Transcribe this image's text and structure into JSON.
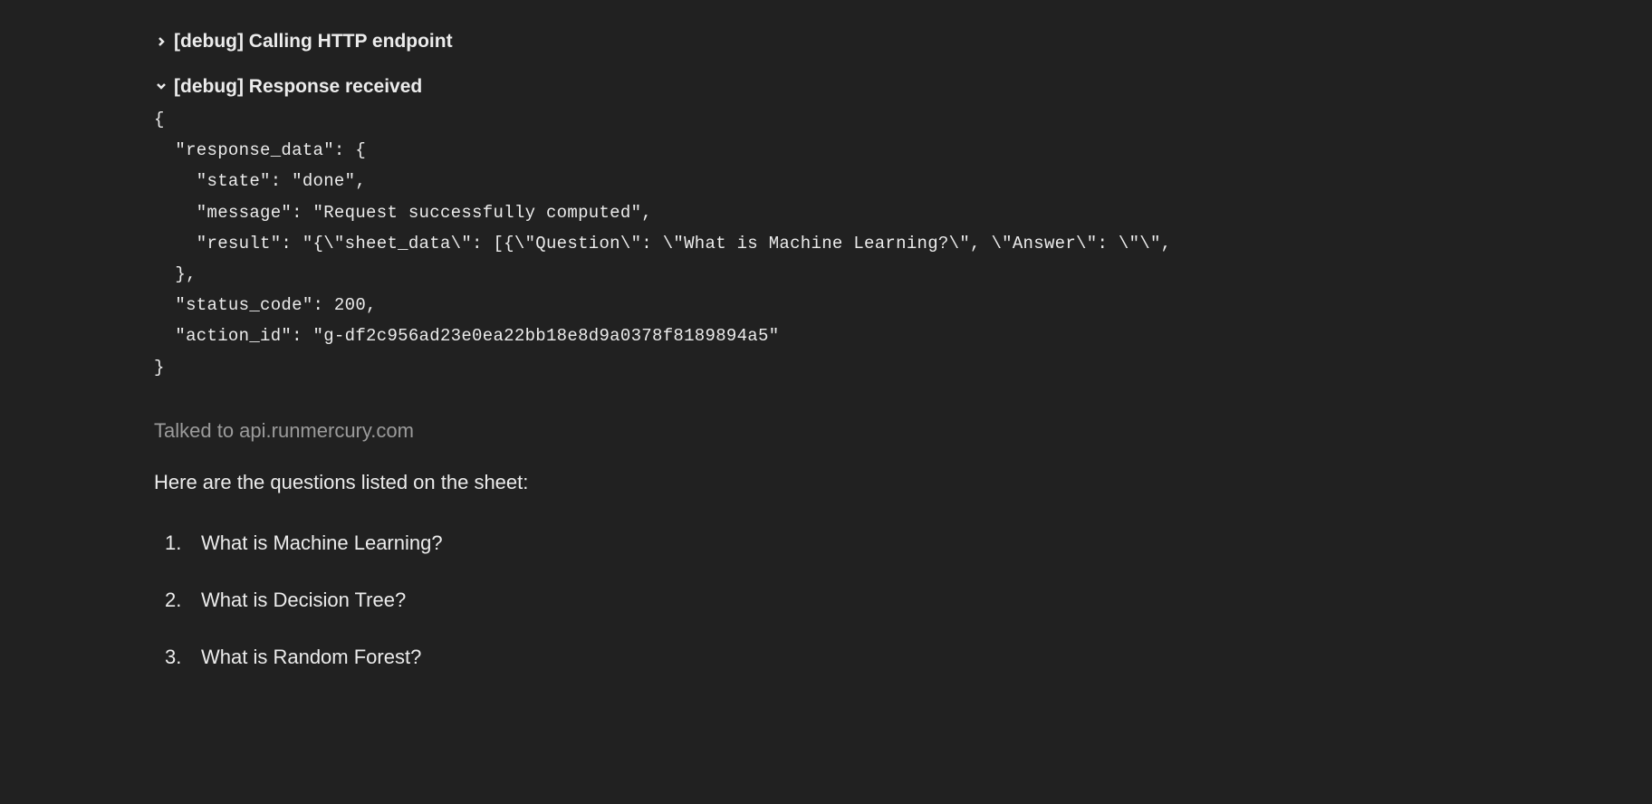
{
  "debug": {
    "collapsed": {
      "label": "[debug] Calling HTTP endpoint"
    },
    "expanded": {
      "label": "[debug] Response received",
      "code": "{\n  \"response_data\": {\n    \"state\": \"done\",\n    \"message\": \"Request successfully computed\",\n    \"result\": \"{\\\"sheet_data\\\": [{\\\"Question\\\": \\\"What is Machine Learning?\\\", \\\"Answer\\\": \\\"\\\",\n  },\n  \"status_code\": 200,\n  \"action_id\": \"g-df2c956ad23e0ea22bb18e8d9a0378f8189894a5\"\n}"
    }
  },
  "status": {
    "talked_to": "Talked to api.runmercury.com"
  },
  "body": {
    "intro": "Here are the questions listed on the sheet:",
    "questions": [
      "What is Machine Learning?",
      "What is Decision Tree?",
      "What is Random Forest?"
    ]
  }
}
